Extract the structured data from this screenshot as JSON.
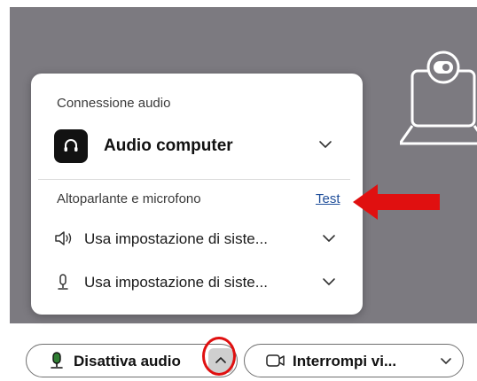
{
  "colors": {
    "video_background": "#7c7a80",
    "link": "#1f4e9a",
    "annotation_red": "#e01010",
    "headset_tile": "#121212"
  },
  "audio_panel": {
    "connection_label": "Connessione audio",
    "source": {
      "label": "Audio computer",
      "icon": "headset-icon"
    },
    "speaker_mic_label": "Altoparlante e microfono",
    "test_link": "Test",
    "speaker": {
      "label": "Usa impostazione di siste...",
      "icon": "speaker-icon"
    },
    "microphone": {
      "label": "Usa impostazione di siste...",
      "icon": "microphone-icon"
    }
  },
  "toolbar": {
    "mute_button": {
      "label": "Disattiva audio",
      "icon": "microphone-icon"
    },
    "video_button": {
      "label": "Interrompi vi...",
      "icon": "video-camera-icon"
    }
  },
  "annotations": [
    "red-arrow-pointing-to-test",
    "red-circle-around-audio-options-caret"
  ]
}
